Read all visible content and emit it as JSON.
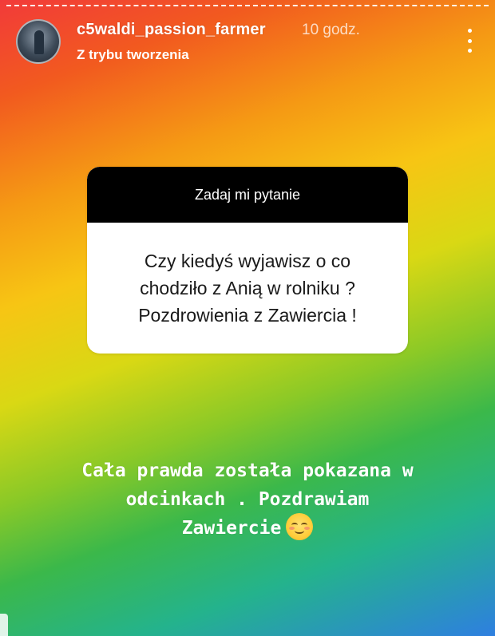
{
  "header": {
    "username": "c5waldi_passion_farmer",
    "timestamp": "10 godz.",
    "subtitle": "Z trybu tworzenia",
    "avatar_icon": "profile-avatar",
    "menu_icon": "more-vertical-icon"
  },
  "question": {
    "title": "Zadaj mi pytanie",
    "lines": [
      "Czy kiedyś wyjawisz o co",
      "chodziło z Anią w rolniku ?",
      "Pozdrowienia z Zawiercia !"
    ]
  },
  "answer": {
    "lines": [
      "Cała prawda została pokazana w",
      "odcinkach . Pozdrawiam",
      "Zawiercie"
    ],
    "emoji": "smiling-face-with-blush-icon"
  },
  "colors": {
    "card_header_bg": "#000000",
    "card_body_bg": "#ffffff",
    "text_on_gradient": "#ffffff"
  }
}
